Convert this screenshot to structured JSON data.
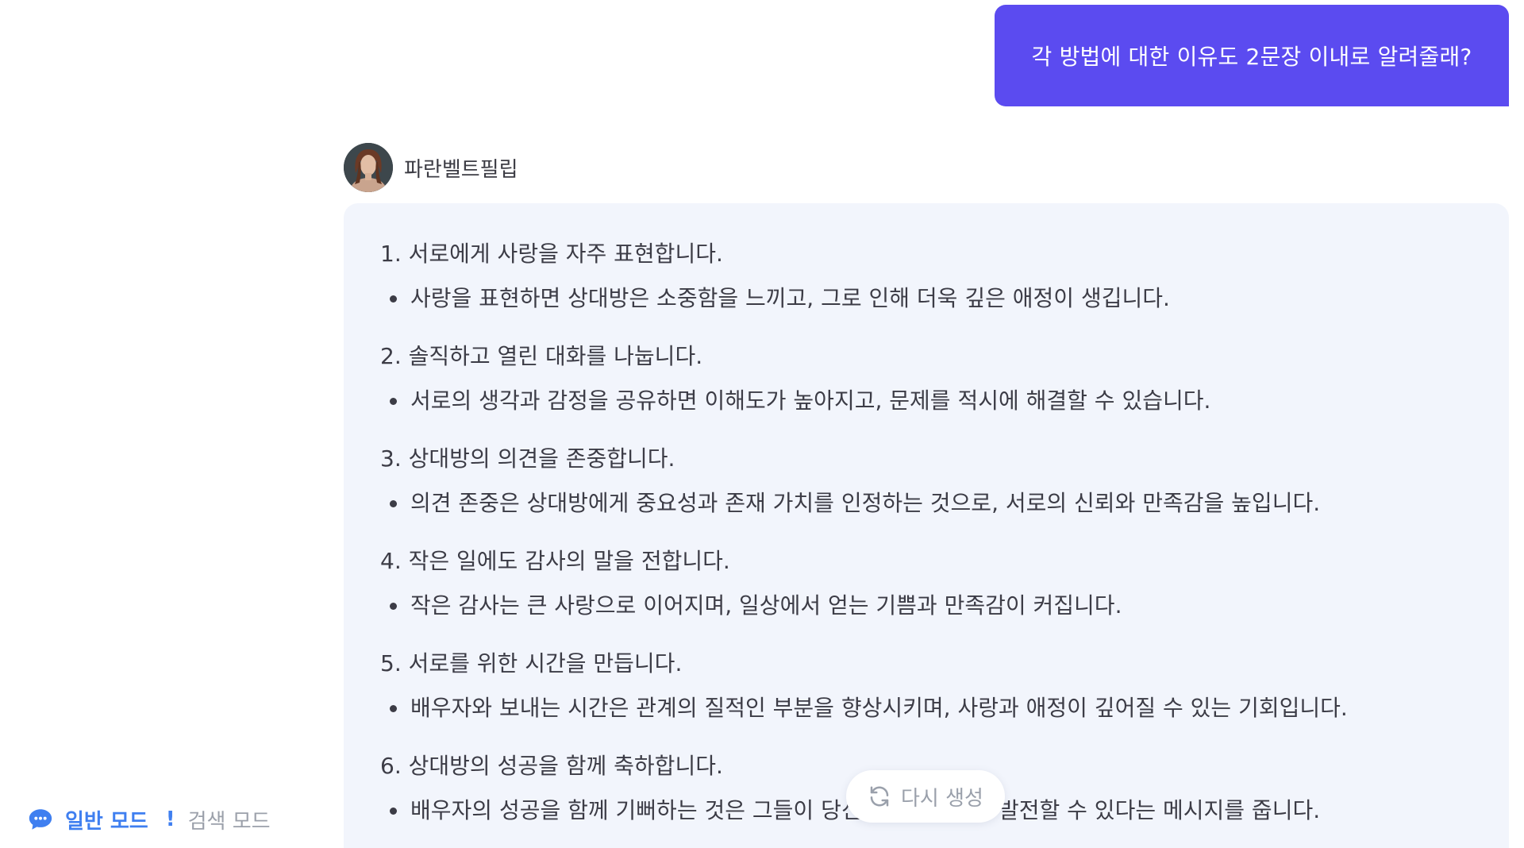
{
  "user_message": "각 방법에 대한 이유도 2문장 이내로 알려줄래?",
  "bot": {
    "name": "파란벨트필립",
    "avatar_icon": "woman-portrait-avatar"
  },
  "answer": {
    "items": [
      {
        "title": "1. 서로에게 사랑을 자주 표현합니다.",
        "reason": "사랑을 표현하면 상대방은 소중함을 느끼고, 그로 인해 더욱 깊은 애정이 생깁니다."
      },
      {
        "title": "2. 솔직하고 열린 대화를 나눕니다.",
        "reason": "서로의 생각과 감정을 공유하면 이해도가 높아지고, 문제를 적시에 해결할 수 있습니다."
      },
      {
        "title": "3. 상대방의 의견을 존중합니다.",
        "reason": "의견 존중은 상대방에게 중요성과 존재 가치를 인정하는 것으로, 서로의 신뢰와 만족감을 높입니다."
      },
      {
        "title": "4. 작은 일에도 감사의 말을 전합니다.",
        "reason": "작은 감사는 큰 사랑으로 이어지며, 일상에서 얻는 기쁨과 만족감이 커집니다."
      },
      {
        "title": "5. 서로를 위한 시간을 만듭니다.",
        "reason": "배우자와 보내는 시간은 관계의 질적인 부분을 향상시키며, 사랑과 애정이 깊어질 수 있는 기회입니다."
      },
      {
        "title": "6. 상대방의 성공을 함께 축하합니다.",
        "reason": "배우자의 성공을 함께 기뻐하는 것은 그들이 당신에게 중요하고 발전할 수 있다는 메시지를 줍니다."
      }
    ]
  },
  "regenerate": {
    "label": "다시 생성",
    "icon": "refresh-icon"
  },
  "mode": {
    "icon": "chat-bubble-icon",
    "normal_label": "일반 모드",
    "separator": "!",
    "search_label": "검색 모드"
  },
  "colors": {
    "accent": "#5b4bf0",
    "mode_active": "#3f7ff0",
    "card_bg": "#f2f5fc"
  }
}
